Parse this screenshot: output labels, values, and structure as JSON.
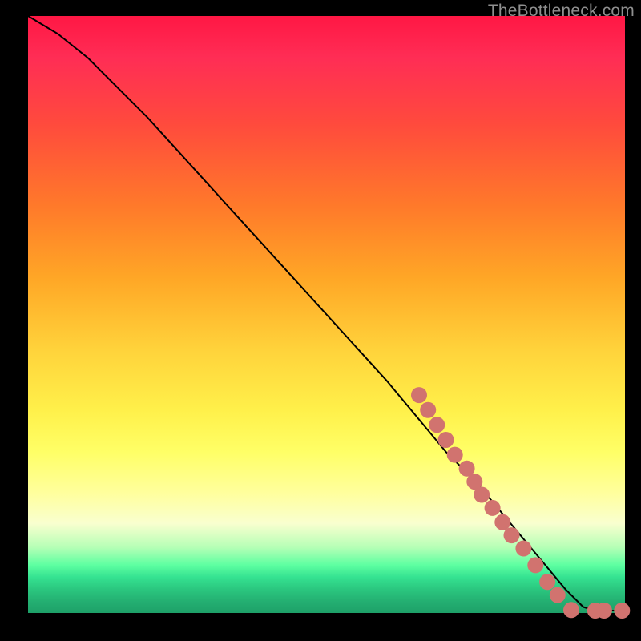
{
  "watermark": "TheBottleneck.com",
  "chart_data": {
    "type": "line",
    "title": "",
    "xlabel": "",
    "ylabel": "",
    "xlim": [
      0,
      100
    ],
    "ylim": [
      0,
      100
    ],
    "series": [
      {
        "name": "curve",
        "x": [
          0,
          5,
          10,
          20,
          30,
          40,
          50,
          60,
          65,
          70,
          75,
          80,
          85,
          90,
          93,
          95,
          97,
          100
        ],
        "y": [
          100,
          97,
          93,
          83,
          72,
          61,
          50,
          39,
          33,
          27,
          22,
          16,
          10,
          4,
          1,
          0.4,
          0.4,
          0.4
        ]
      }
    ],
    "markers": [
      {
        "x": 65.5,
        "y": 36.5
      },
      {
        "x": 67.0,
        "y": 34.0
      },
      {
        "x": 68.5,
        "y": 31.5
      },
      {
        "x": 70.0,
        "y": 29.0
      },
      {
        "x": 71.5,
        "y": 26.5
      },
      {
        "x": 73.5,
        "y": 24.2
      },
      {
        "x": 74.8,
        "y": 22.0
      },
      {
        "x": 76.0,
        "y": 19.8
      },
      {
        "x": 77.8,
        "y": 17.6
      },
      {
        "x": 79.5,
        "y": 15.2
      },
      {
        "x": 81.0,
        "y": 13.0
      },
      {
        "x": 83.0,
        "y": 10.8
      },
      {
        "x": 85.0,
        "y": 8.0
      },
      {
        "x": 87.0,
        "y": 5.2
      },
      {
        "x": 88.7,
        "y": 3.0
      },
      {
        "x": 91.0,
        "y": 0.5
      },
      {
        "x": 95.0,
        "y": 0.4
      },
      {
        "x": 96.5,
        "y": 0.4
      },
      {
        "x": 99.5,
        "y": 0.4
      }
    ],
    "marker_color": "#d1736f",
    "curve_color": "#000000"
  }
}
